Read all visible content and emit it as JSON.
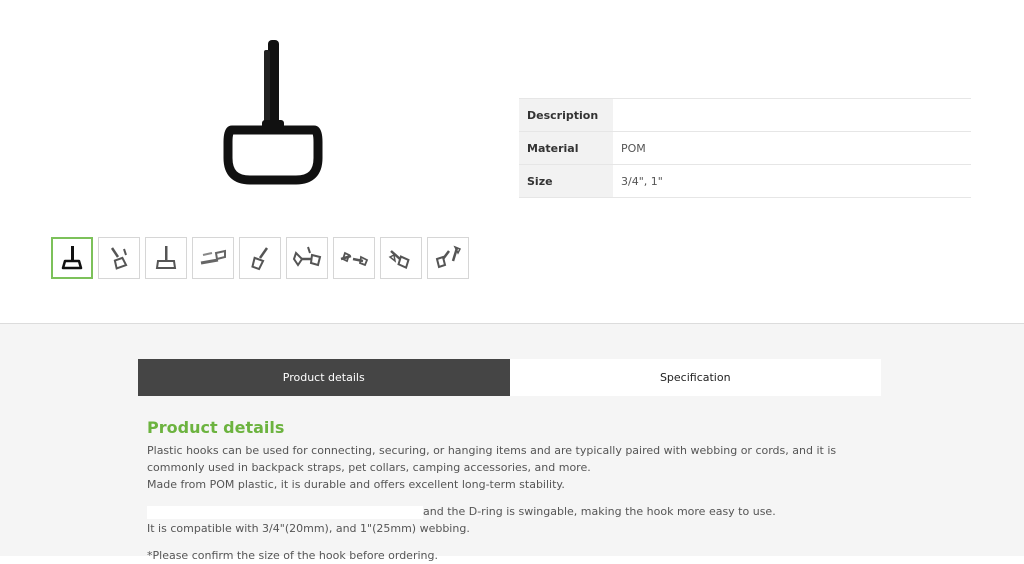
{
  "product": {
    "main_image_icon": "d-ring-swivel-hook",
    "thumbnails": [
      {
        "icon": "d-ring-hook-front"
      },
      {
        "icon": "d-ring-hook-angle"
      },
      {
        "icon": "d-ring-hook-upright"
      },
      {
        "icon": "d-ring-hook-with-webbing"
      },
      {
        "icon": "d-ring-hook-tilted"
      },
      {
        "icon": "d-ring-hook-pair"
      },
      {
        "icon": "d-ring-hook-side"
      },
      {
        "icon": "d-ring-hook-diagonal"
      },
      {
        "icon": "d-ring-hook-parts"
      }
    ]
  },
  "specs": [
    {
      "label": "Description",
      "value": ""
    },
    {
      "label": "Material",
      "value": "POM"
    },
    {
      "label": "Size",
      "value": "3/4\", 1\""
    }
  ],
  "tabs": [
    {
      "label": "Product details"
    },
    {
      "label": "Specification"
    }
  ],
  "details": {
    "heading": "Product details",
    "p1": "Plastic hooks can be used for connecting, securing, or hanging items and are typically paired with webbing or cords, and it is commonly used in backpack straps, pet collars, camping accessories, and more.",
    "p2": "Made from POM plastic, it is durable and offers excellent long-term stability.",
    "p3": "and the D-ring is swingable, making the hook more easy to use.",
    "p4": "It is compatible with 3/4\"(20mm), and 1\"(25mm) webbing.",
    "p5": "*Please confirm the size of the hook before ordering."
  },
  "colors": {
    "accent": "#6cb33f",
    "active_tab": "#454545",
    "lower_bg": "#f5f5f5"
  }
}
